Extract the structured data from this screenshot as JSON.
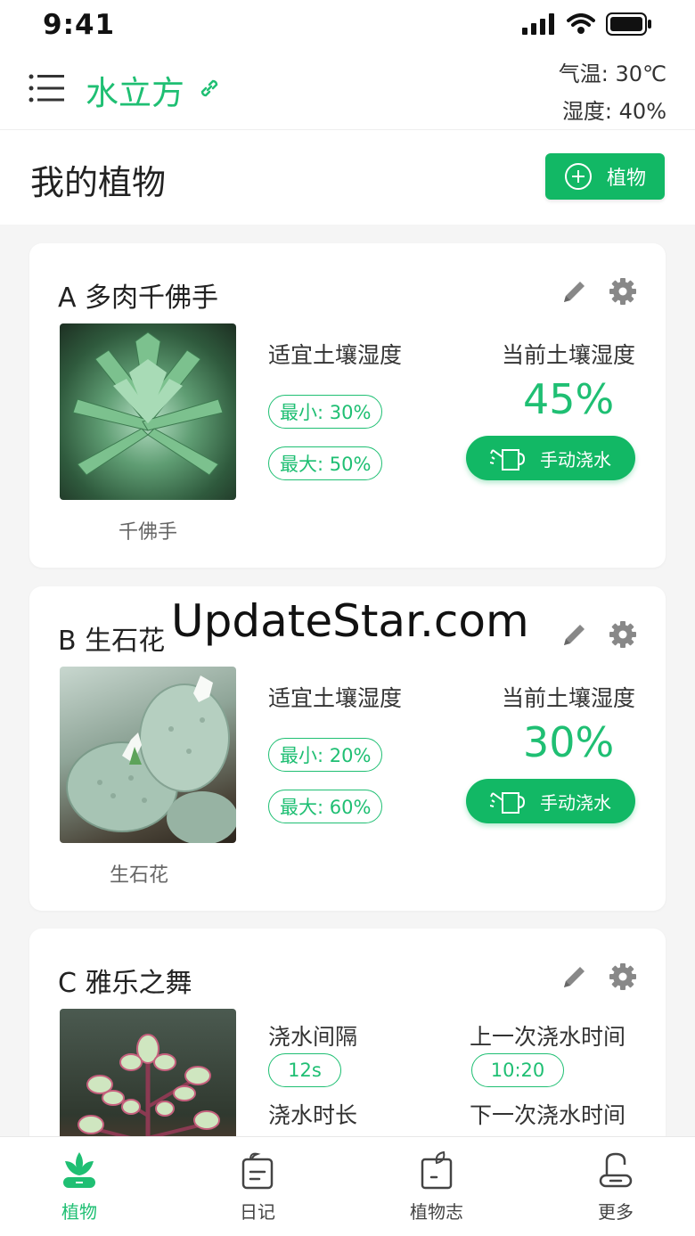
{
  "status_bar": {
    "time": "9:41"
  },
  "header": {
    "title": "水立方",
    "temperature": "气温: 30℃",
    "humidity": "湿度: 40%"
  },
  "section": {
    "title": "我的植物",
    "add_label": "植物"
  },
  "cards": [
    {
      "title": "A 多肉千佛手",
      "caption": "千佛手",
      "soil_label": "适宜土壤湿度",
      "min": "最小: 30%",
      "max": "最大: 50%",
      "current_label": "当前土壤湿度",
      "current_value": "45%",
      "water_label": "手动浇水"
    },
    {
      "title": "B 生石花",
      "caption": "生石花",
      "soil_label": "适宜土壤湿度",
      "min": "最小: 20%",
      "max": "最大: 60%",
      "current_label": "当前土壤湿度",
      "current_value": "30%",
      "water_label": "手动浇水"
    },
    {
      "title": "C 雅乐之舞",
      "interval_label": "浇水间隔",
      "interval_value": "12s",
      "last_label": "上一次浇水时间",
      "last_value": "10:20",
      "duration_label": "浇水时长",
      "next_label": "下一次浇水时间"
    }
  ],
  "watermark": "UpdateStar.com",
  "tabs": [
    {
      "label": "植物",
      "icon": "plant-icon",
      "active": true
    },
    {
      "label": "日记",
      "icon": "diary-icon"
    },
    {
      "label": "植物志",
      "icon": "encyclopedia-icon"
    },
    {
      "label": "更多",
      "icon": "more-icon"
    }
  ],
  "colors": {
    "accent": "#1fbf73",
    "button": "#12b865"
  }
}
